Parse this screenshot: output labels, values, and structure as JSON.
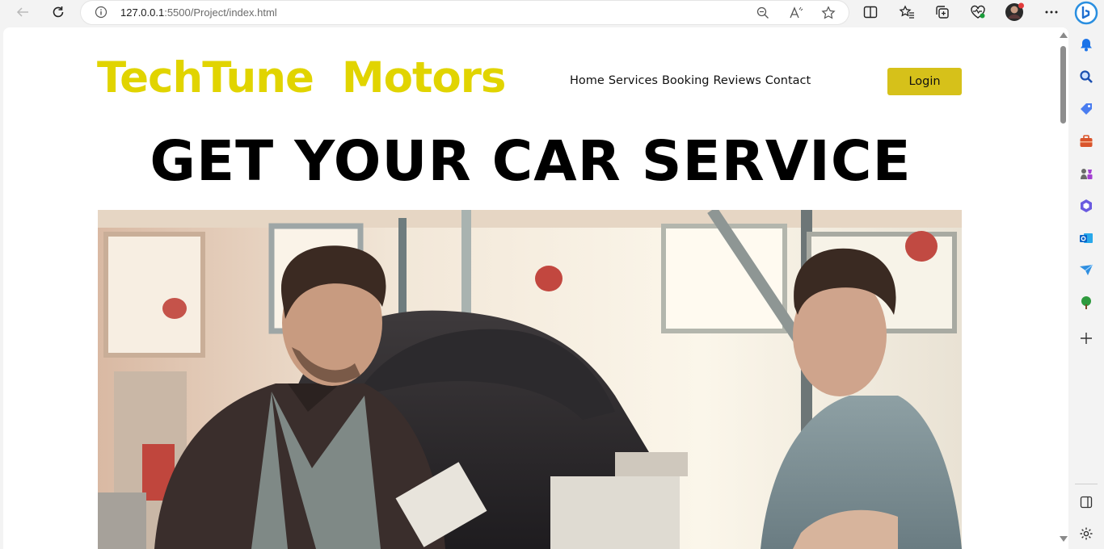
{
  "browser": {
    "url_host": "127.0.0.1",
    "url_rest": ":5500/Project/index.html"
  },
  "site": {
    "brand": "TechTune  Motors",
    "nav": [
      "Home",
      "Services",
      "Booking",
      "Reviews",
      "Contact"
    ],
    "login_label": "Login",
    "hero_title": "GET YOUR CAR SERVICE"
  },
  "colors": {
    "brand": "#e1d400",
    "login_button": "#d6c11a"
  },
  "icons": {
    "toolbar": [
      "back-icon",
      "refresh-icon",
      "info-icon",
      "zoom-out-icon",
      "read-aloud-icon",
      "favorite-star-icon",
      "split-screen-icon",
      "favorites-icon",
      "collections-icon",
      "browser-essentials-icon",
      "profile-avatar",
      "more-icon",
      "copilot-icon"
    ],
    "sidebar": [
      "notifications-icon",
      "search-icon",
      "shopping-icon",
      "tools-icon",
      "games-icon",
      "microsoft365-icon",
      "outlook-icon",
      "drop-icon",
      "tree-icon",
      "add-icon",
      "sidebar-toggle-icon",
      "settings-icon"
    ]
  }
}
